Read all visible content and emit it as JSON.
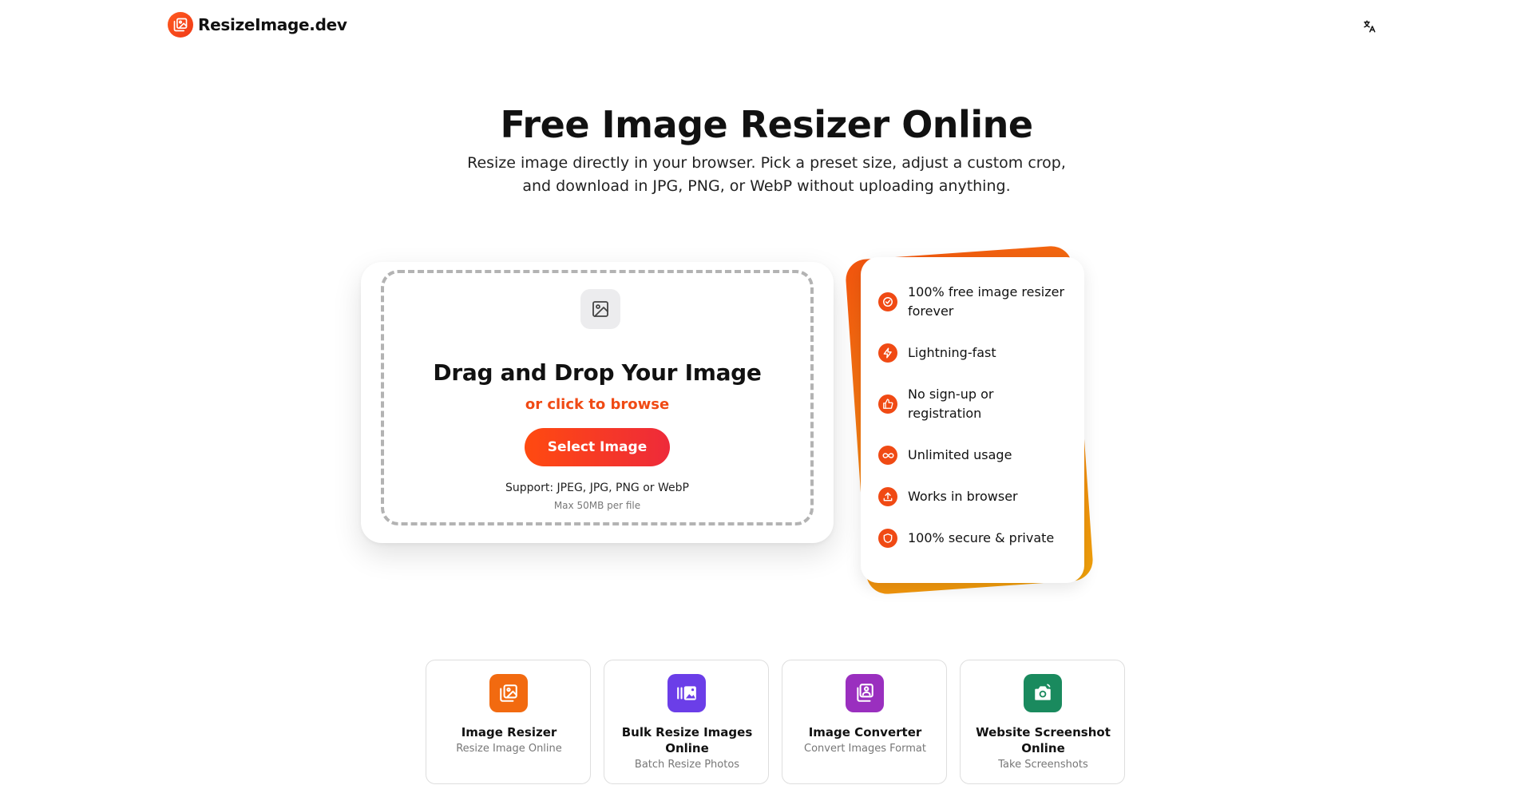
{
  "header": {
    "logo_text": "ResizeImage.dev",
    "language_icon": "translate-icon"
  },
  "hero": {
    "title": "Free Image Resizer Online",
    "subtitle": "Resize image directly in your browser. Pick a preset size, adjust a custom crop, and download in JPG, PNG, or WebP without uploading anything."
  },
  "upload": {
    "icon": "image-icon",
    "title": "Drag and Drop Your Image",
    "browse_text": "or click to browse",
    "button_label": "Select Image",
    "support_text": "Support: JPEG, JPG, PNG or WebP",
    "max_text": "Max 50MB per file"
  },
  "features": {
    "items": [
      {
        "label": "100% free image resizer forever",
        "icon": "check-circle-icon"
      },
      {
        "label": "Lightning-fast",
        "icon": "lightning-icon"
      },
      {
        "label": "No sign-up or registration",
        "icon": "thumbs-up-icon"
      },
      {
        "label": "Unlimited usage",
        "icon": "infinity-icon"
      },
      {
        "label": "Works in browser",
        "icon": "upload-icon"
      },
      {
        "label": "100% secure & private",
        "icon": "shield-icon"
      }
    ]
  },
  "tools": [
    {
      "name": "Image Resizer",
      "desc": "Resize Image Online",
      "color": "#f26a10",
      "icon": "resize-icon"
    },
    {
      "name": "Bulk Resize Images Online",
      "desc": "Batch Resize Photos",
      "color": "#6b3ee8",
      "icon": "gallery-icon"
    },
    {
      "name": "Image Converter",
      "desc": "Convert Images Format",
      "color": "#9a2fbf",
      "icon": "convert-icon"
    },
    {
      "name": "Website Screenshot Online",
      "desc": "Take Screenshots",
      "color": "#1a8a5e",
      "icon": "camera-icon"
    }
  ],
  "colors": {
    "accent": "#f04a14",
    "button_gradient_start": "#ff4a10",
    "button_gradient_end": "#ee2a3a"
  }
}
